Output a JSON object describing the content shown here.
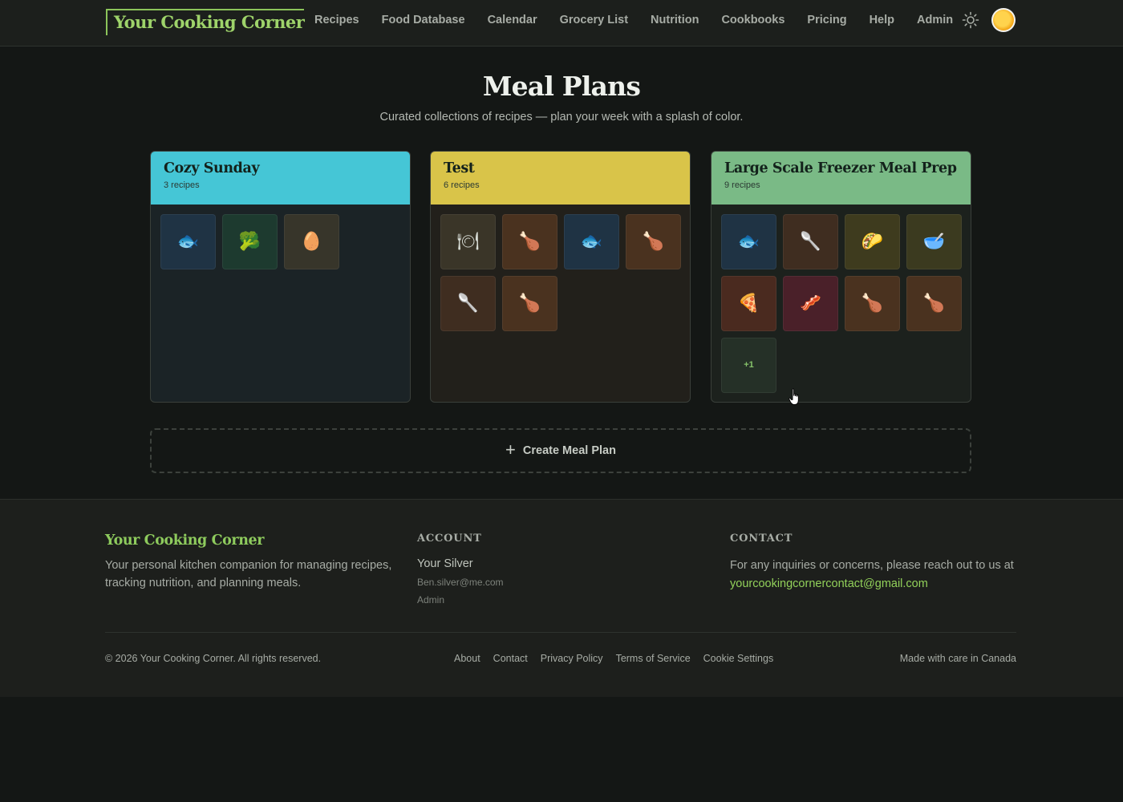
{
  "header": {
    "logo": "Your Cooking Corner",
    "nav": [
      "Recipes",
      "Food Database",
      "Calendar",
      "Grocery List",
      "Nutrition",
      "Cookbooks",
      "Pricing",
      "Help",
      "Admin"
    ],
    "theme_icon": "sun-icon",
    "avatar_icon": "user-avatar"
  },
  "main": {
    "title": "Meal Plans",
    "subtitle": "Curated collections of recipes — plan your week with a splash of color.",
    "create_label": "Create Meal Plan",
    "create_icon": "plus-icon"
  },
  "meal_plans": [
    {
      "title": "Cozy Sunday",
      "count": "3 recipes",
      "header_color": "#45c6d6",
      "body_color": "#1b2326",
      "thumbs": [
        {
          "icon": "fish-icon",
          "glyph": "🐟",
          "bg": "#1f3344"
        },
        {
          "icon": "broccoli-icon",
          "glyph": "🥦",
          "bg": "#1d3a2f"
        },
        {
          "icon": "egg-icon",
          "glyph": "🥚",
          "bg": "#37352a"
        }
      ]
    },
    {
      "title": "Test",
      "count": "6 recipes",
      "header_color": "#d9c449",
      "body_color": "#22201b",
      "thumbs": [
        {
          "icon": "plate-icon",
          "glyph": "🍽",
          "bg": "#3a3528"
        },
        {
          "icon": "drumstick-icon",
          "glyph": "🍗",
          "bg": "#4a321f"
        },
        {
          "icon": "fish-icon",
          "glyph": "🐟",
          "bg": "#1f3344"
        },
        {
          "icon": "drumstick-icon",
          "glyph": "🍗",
          "bg": "#4a321f"
        },
        {
          "icon": "spoon-icon",
          "glyph": "🥄",
          "bg": "#3f2d20"
        },
        {
          "icon": "drumstick-icon",
          "glyph": "🍗",
          "bg": "#4a321f"
        }
      ]
    },
    {
      "title": "Large Scale Freezer Meal Prep",
      "count": "9 recipes",
      "header_color": "#7aba86",
      "body_color": "#1c211d",
      "thumbs": [
        {
          "icon": "fish-icon",
          "glyph": "🐟",
          "bg": "#1f3344"
        },
        {
          "icon": "spoon-icon",
          "glyph": "🥄",
          "bg": "#3f2d20"
        },
        {
          "icon": "taco-icon",
          "glyph": "🌮",
          "bg": "#3e3b1e"
        },
        {
          "icon": "mixing-bowl-icon",
          "glyph": "🥣",
          "bg": "#3b3a1f"
        },
        {
          "icon": "pizza-icon",
          "glyph": "🍕",
          "bg": "#4a2a1f"
        },
        {
          "icon": "bacon-icon",
          "glyph": "🥓",
          "bg": "#4a2029"
        },
        {
          "icon": "drumstick-icon",
          "glyph": "🍗",
          "bg": "#4a321f"
        },
        {
          "icon": "drumstick-icon",
          "glyph": "🍗",
          "bg": "#4a321f"
        },
        {
          "icon": "more-count",
          "glyph": "+1",
          "bg": "#253027",
          "more": true
        }
      ]
    }
  ],
  "footer": {
    "brand": "Your Cooking Corner",
    "description": "Your personal kitchen companion for managing recipes, tracking nutrition, and planning meals.",
    "account_heading": "ACCOUNT",
    "account_name": "Your Silver",
    "account_email": "Ben.silver@me.com",
    "account_role": "Admin",
    "contact_heading": "CONTACT",
    "contact_text": "For any inquiries or concerns, please reach out to us at",
    "contact_email": "yourcookingcornercontact@gmail.com",
    "copyright": "© 2026 Your Cooking Corner. All rights reserved.",
    "links": [
      "About",
      "Contact",
      "Privacy Policy",
      "Terms of Service",
      "Cookie Settings"
    ],
    "made_with": "Made with care in Canada"
  }
}
